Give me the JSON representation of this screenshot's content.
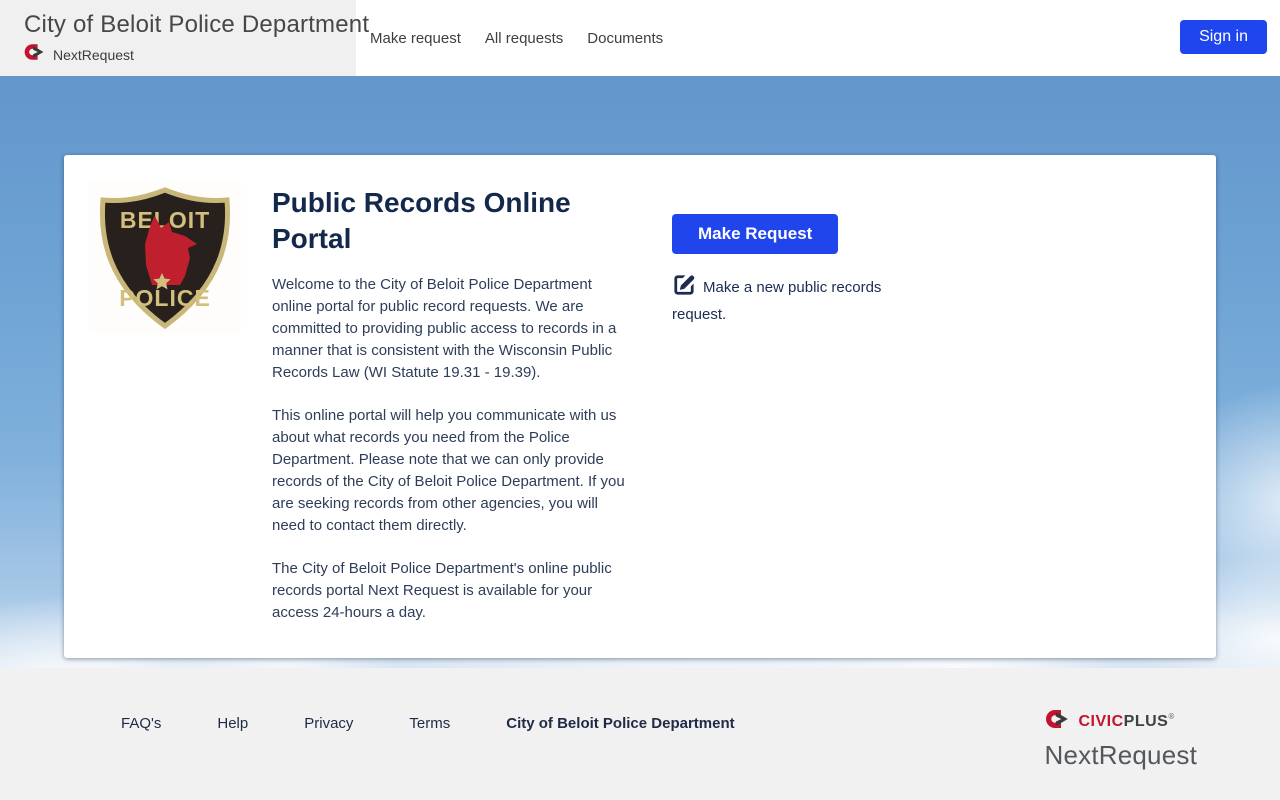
{
  "header": {
    "title": "City of Beloit Police Department",
    "brand": "NextRequest",
    "nav": [
      {
        "label": "Make request"
      },
      {
        "label": "All requests"
      },
      {
        "label": "Documents"
      }
    ],
    "sign_in_label": "Sign in"
  },
  "card": {
    "badge": {
      "top_text": "BELOIT",
      "bottom_text": "POLICE"
    },
    "title": "Public Records Online Portal",
    "paragraphs": [
      "Welcome to the City of Beloit Police Department online portal for public record requests. We are committed to providing public access to records in a manner that is consistent with the Wisconsin Public Records Law (WI Statute 19.31 - 19.39).",
      "This online portal will help you communicate with us about what records you need from the Police Department. Please note that we can only provide records of the City of Beloit Police Department. If you are seeking records from other agencies, you will need to contact them directly.",
      "The City of Beloit Police Department's online public records portal Next Request is available for your access 24-hours a day."
    ],
    "make_request_label": "Make Request",
    "make_request_hint": "Make a new public records request."
  },
  "footer": {
    "links": [
      {
        "label": "FAQ's"
      },
      {
        "label": "Help"
      },
      {
        "label": "Privacy"
      },
      {
        "label": "Terms"
      }
    ],
    "agency_link": "City of Beloit Police Department",
    "civicplus_civic": "CIVIC",
    "civicplus_plus": "PLUS",
    "product_name": "NextRequest"
  },
  "colors": {
    "accent_blue": "#2145ec",
    "civicplus_red": "#c41230",
    "badge_red": "#c01f2e",
    "badge_gold": "#d3bf7d",
    "sky_top": "#6397cc",
    "footer_bg": "#f1f1f2"
  }
}
